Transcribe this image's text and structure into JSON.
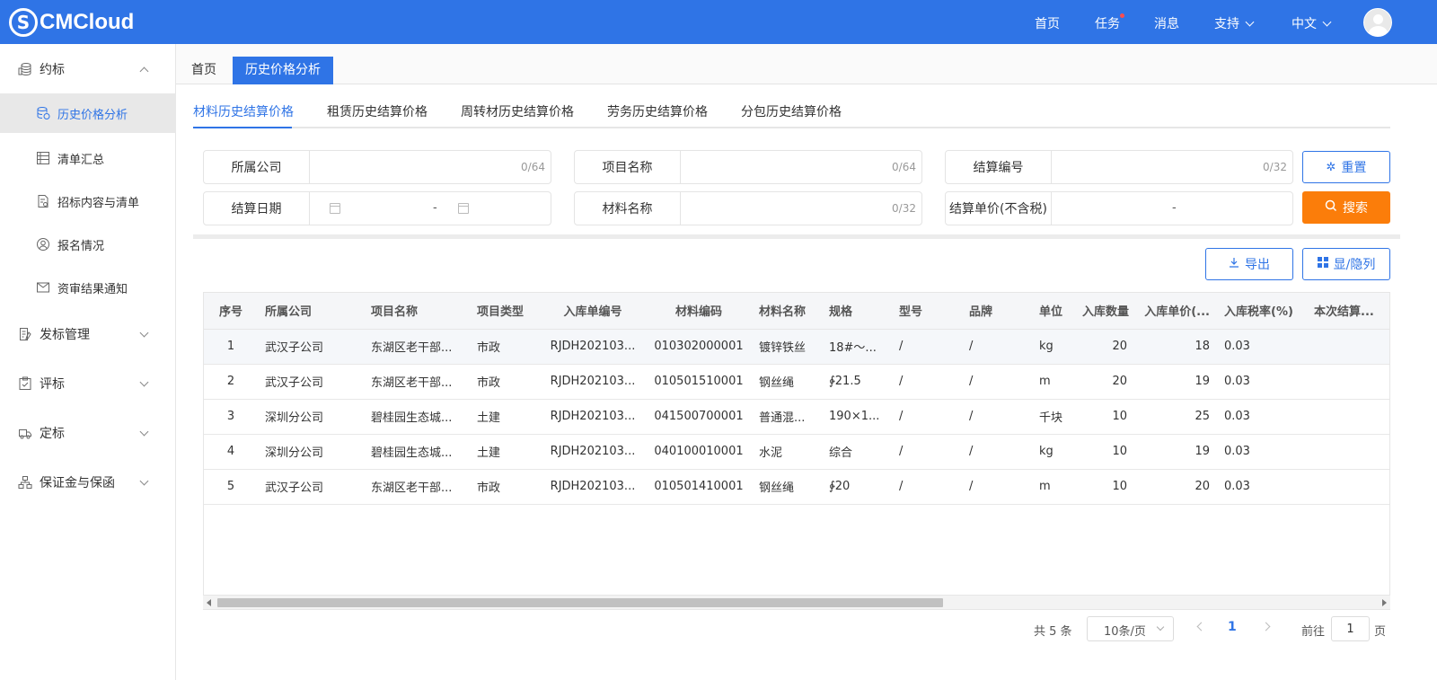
{
  "header": {
    "logo_mark": "S",
    "logo_text": "CMCloud",
    "nav": [
      "首页",
      "任务",
      "消息",
      "支持",
      "中文"
    ]
  },
  "sidebar": {
    "groups": [
      {
        "label": "约标",
        "icon": "coins-icon",
        "expanded": true,
        "items": [
          {
            "label": "历史价格分析",
            "icon": "database-icon",
            "active": true
          },
          {
            "label": "清单汇总",
            "icon": "list-icon"
          },
          {
            "label": "招标内容与清单",
            "icon": "document-icon"
          },
          {
            "label": "报名情况",
            "icon": "user-circle-icon"
          },
          {
            "label": "资审结果通知",
            "icon": "mail-icon"
          }
        ]
      },
      {
        "label": "发标管理",
        "icon": "doc-edit-icon"
      },
      {
        "label": "评标",
        "icon": "clipboard-check-icon"
      },
      {
        "label": "定标",
        "icon": "truck-icon"
      },
      {
        "label": "保证金与保函",
        "icon": "hierarchy-icon"
      }
    ]
  },
  "page_tabs": [
    "首页",
    "历史价格分析"
  ],
  "sub_tabs": [
    "材料历史结算价格",
    "租赁历史结算价格",
    "周转材历史结算价格",
    "劳务历史结算价格",
    "分包历史结算价格"
  ],
  "filters": {
    "company": {
      "label": "所属公司",
      "counter": "0/64"
    },
    "project": {
      "label": "项目名称",
      "counter": "0/64"
    },
    "settle_no": {
      "label": "结算编号",
      "counter": "0/32"
    },
    "settle_date": {
      "label": "结算日期",
      "separator": "-"
    },
    "material": {
      "label": "材料名称",
      "counter": "0/32"
    },
    "unit_price": {
      "label": "结算单价(不含税)",
      "separator": "-"
    }
  },
  "buttons": {
    "reset": "重置",
    "search": "搜索",
    "export": "导出",
    "toggle_columns": "显/隐列"
  },
  "table": {
    "columns": [
      "序号",
      "所属公司",
      "项目名称",
      "项目类型",
      "入库单编号",
      "材料编码",
      "材料名称",
      "规格",
      "型号",
      "品牌",
      "单位",
      "入库数量",
      "入库单价(...",
      "入库税率(%)",
      "本次结算..."
    ],
    "rows": [
      [
        "1",
        "武汉子公司",
        "东湖区老干部...",
        "市政",
        "RJDH202103...",
        "010302000001",
        "镀锌铁丝",
        "18#～...",
        "/",
        "/",
        "kg",
        "20",
        "18",
        "0.03",
        ""
      ],
      [
        "2",
        "武汉子公司",
        "东湖区老干部...",
        "市政",
        "RJDH202103...",
        "010501510001",
        "钢丝绳",
        "∲21.5",
        "/",
        "/",
        "m",
        "20",
        "19",
        "0.03",
        ""
      ],
      [
        "3",
        "深圳分公司",
        "碧桂园生态城...",
        "土建",
        "RJDH202103...",
        "041500700001",
        "普通混...",
        "190×1...",
        "/",
        "/",
        "千块",
        "10",
        "25",
        "0.03",
        ""
      ],
      [
        "4",
        "深圳分公司",
        "碧桂园生态城...",
        "土建",
        "RJDH202103...",
        "040100010001",
        "水泥",
        "综合",
        "/",
        "/",
        "kg",
        "10",
        "19",
        "0.03",
        ""
      ],
      [
        "5",
        "武汉子公司",
        "东湖区老干部...",
        "市政",
        "RJDH202103...",
        "010501410001",
        "钢丝绳",
        "∲20",
        "/",
        "/",
        "m",
        "10",
        "20",
        "0.03",
        ""
      ]
    ]
  },
  "pagination": {
    "total": "共 5 条",
    "page_size": "10条/页",
    "current_page": "1",
    "goto_prefix": "前往",
    "goto_value": "1",
    "goto_suffix": "页"
  },
  "colors": {
    "primary": "#2f74e6",
    "search_button": "#fb7d0a",
    "task_dot": "#ff4d4f"
  }
}
